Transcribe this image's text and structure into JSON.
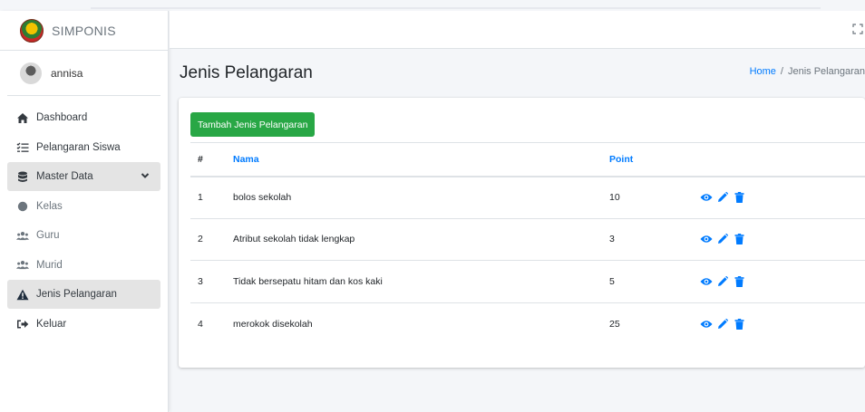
{
  "app": {
    "brand": "SIMPONIS",
    "user": "annisa"
  },
  "sidebar": {
    "items": [
      {
        "label": "Dashboard",
        "icon": "home-icon"
      },
      {
        "label": "Pelangaran Siswa",
        "icon": "list-check-icon"
      },
      {
        "label": "Master Data",
        "icon": "database-icon",
        "expanded": true
      },
      {
        "label": "Kelas",
        "icon": "circle-icon"
      },
      {
        "label": "Guru",
        "icon": "users-icon"
      },
      {
        "label": "Murid",
        "icon": "users-icon"
      },
      {
        "label": "Jenis Pelangaran",
        "icon": "warning-icon",
        "active": true
      },
      {
        "label": "Keluar",
        "icon": "sign-out-icon"
      }
    ]
  },
  "header": {
    "title": "Jenis Pelangaran",
    "breadcrumb": {
      "home": "Home",
      "separator": "/",
      "current": "Jenis Pelangaran"
    }
  },
  "card": {
    "add_button": "Tambah Jenis Pelangaran",
    "table": {
      "columns": [
        "#",
        "Nama",
        "Point",
        ""
      ],
      "rows": [
        {
          "no": "1",
          "nama": "bolos sekolah",
          "point": "10"
        },
        {
          "no": "2",
          "nama": "Atribut sekolah tidak lengkap",
          "point": "3"
        },
        {
          "no": "3",
          "nama": "Tidak bersepatu hitam dan kos kaki",
          "point": "5"
        },
        {
          "no": "4",
          "nama": "merokok disekolah",
          "point": "25"
        }
      ]
    }
  },
  "colors": {
    "primary": "#007bff",
    "success": "#28a745",
    "active_bg": "#e4e4e4"
  }
}
